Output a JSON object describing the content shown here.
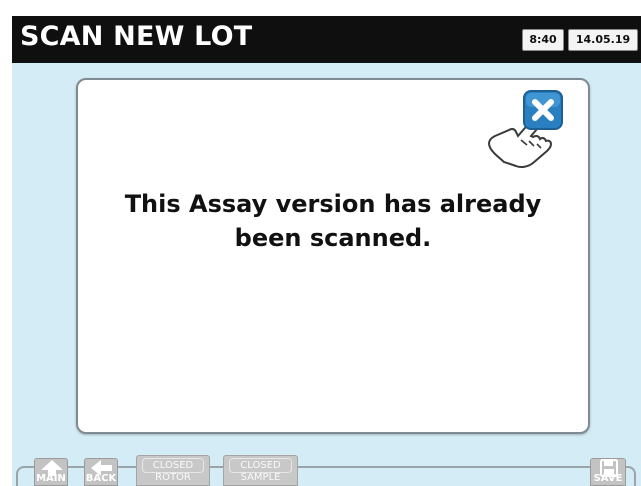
{
  "header": {
    "title": "SCAN NEW LOT",
    "time": "8:40",
    "date": "14.05.19"
  },
  "dialog": {
    "message_line1": "This Assay version has already",
    "message_line2": "been scanned.",
    "close_icon": "close-x-icon",
    "hand_icon": "pointing-hand-icon"
  },
  "bottom_bar": {
    "main_label": "MAIN",
    "back_label": "BACK",
    "closed_rotor_top": "CLOSED",
    "closed_rotor_bottom": "ROTOR",
    "closed_sample_top": "CLOSED",
    "closed_sample_bottom": "SAMPLE",
    "save_label": "SAVE"
  },
  "colors": {
    "screen_background": "#d4ecf6",
    "title_bar": "#0f0f0f",
    "close_button": "#2a7fc1",
    "disabled_button": "#c3c3c3"
  }
}
